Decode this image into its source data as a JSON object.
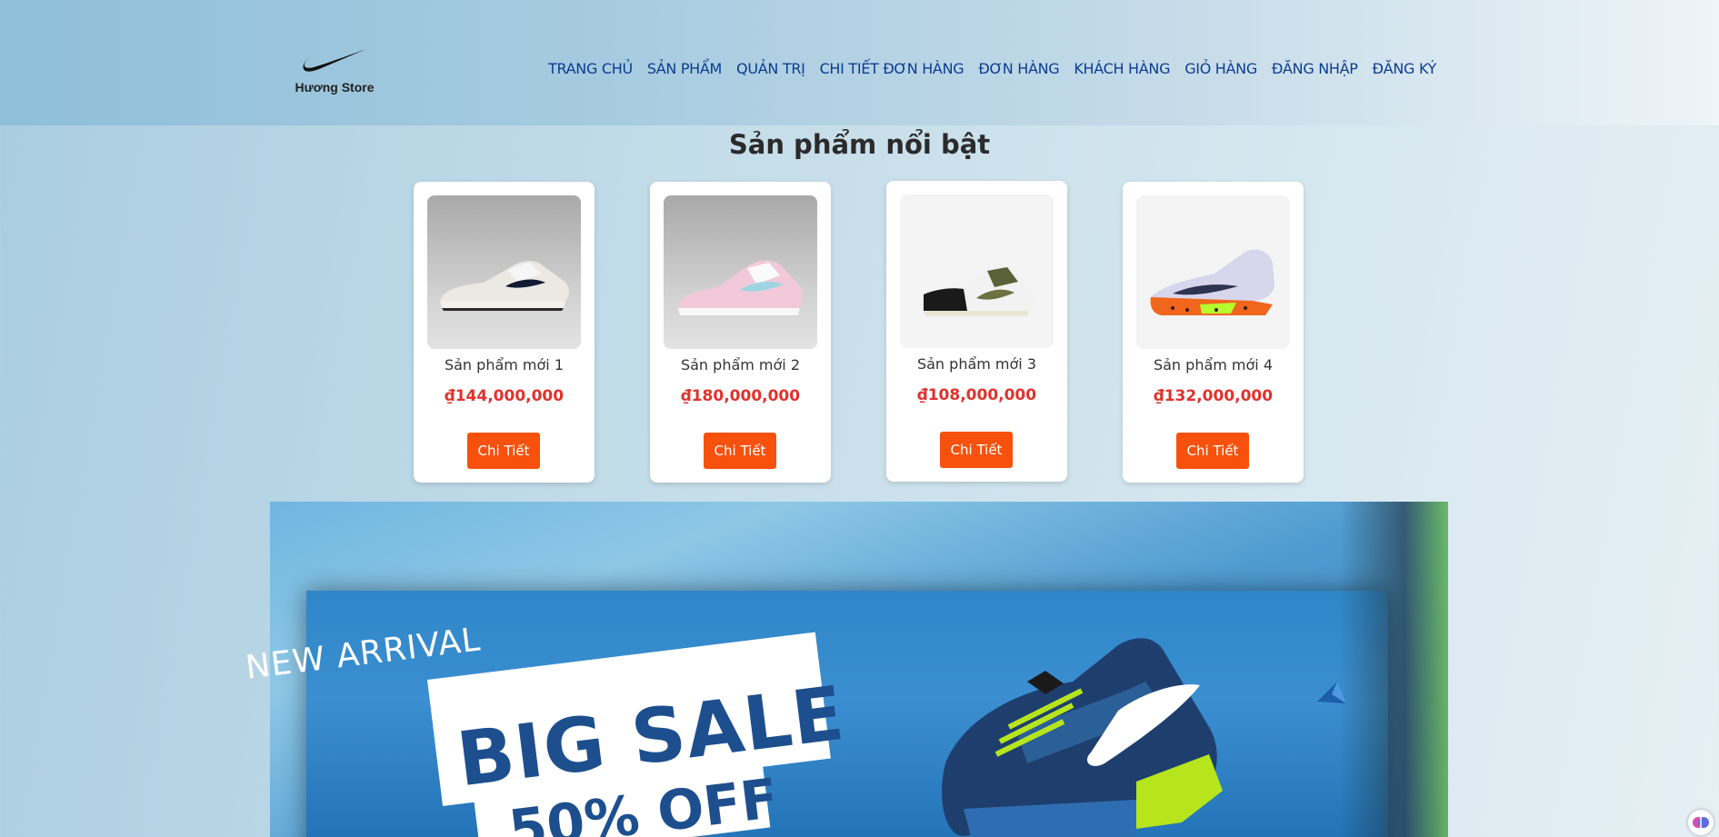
{
  "brand": {
    "name": "Hương Store",
    "logo_icon": "swoosh-icon"
  },
  "nav": [
    "TRANG CHỦ",
    "SẢN PHẨM",
    "QUẢN TRỊ",
    "CHI TIẾT ĐƠN HÀNG",
    "ĐƠN HÀNG",
    "KHÁCH HÀNG",
    "GIỎ HÀNG",
    "ĐĂNG NHẬP",
    "ĐĂNG KÝ"
  ],
  "featured": {
    "title": "Sản phẩm nổi bật",
    "products": [
      {
        "name": "Sản phẩm mới 1",
        "price": "₫144,000,000",
        "button": "Chi Tiết"
      },
      {
        "name": "Sản phẩm mới 2",
        "price": "₫180,000,000",
        "button": "Chi Tiết"
      },
      {
        "name": "Sản phẩm mới 3",
        "price": "₫108,000,000",
        "button": "Chi Tiết"
      },
      {
        "name": "Sản phẩm mới 4",
        "price": "₫132,000,000",
        "button": "Chi Tiết"
      }
    ]
  },
  "banner": {
    "line1": "NEW ARRIVAL",
    "line2": "BIG SALE",
    "line3": "50% OFF"
  },
  "colors": {
    "accent": "#f7510d",
    "price": "#e0322b",
    "nav": "#0b3d91"
  }
}
